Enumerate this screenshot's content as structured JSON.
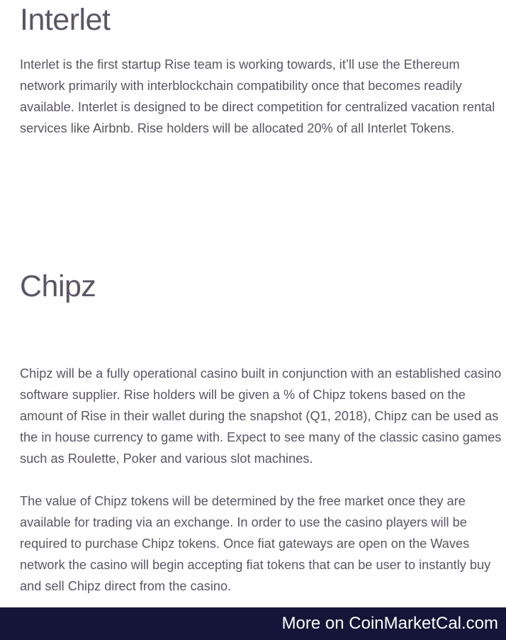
{
  "sections": [
    {
      "title": "Interlet",
      "paragraphs": [
        "Interlet is the first startup Rise team is working towards, it’ll use the Ethereum network primarily with interblockchain compatibility once that becomes readily available. Interlet is designed to be direct competition for centralized vacation rental services like Airbnb. Rise holders will be allocated 20% of all Interlet Tokens."
      ]
    },
    {
      "title": "Chipz",
      "paragraphs": [
        "Chipz will be a fully operational casino built in conjunction with an established casino software supplier. Rise holders will be given a % of Chipz tokens based on the amount of Rise in their wallet during the snapshot (Q1, 2018), Chipz can be used as the in house currency to game with. Expect to see many of the classic casino games such as Roulette, Poker and various slot machines.",
        "The value of Chipz tokens will be determined by the free market once they are available for trading via an exchange. In order to use the casino players will be required to purchase Chipz tokens. Once fiat gateways are open on the Waves network the casino will begin accepting fiat tokens that can be user to instantly buy and sell Chipz direct from the casino."
      ]
    }
  ],
  "footer": {
    "link_text": "More on CoinMarketCal.com",
    "background_color": "#141538"
  }
}
